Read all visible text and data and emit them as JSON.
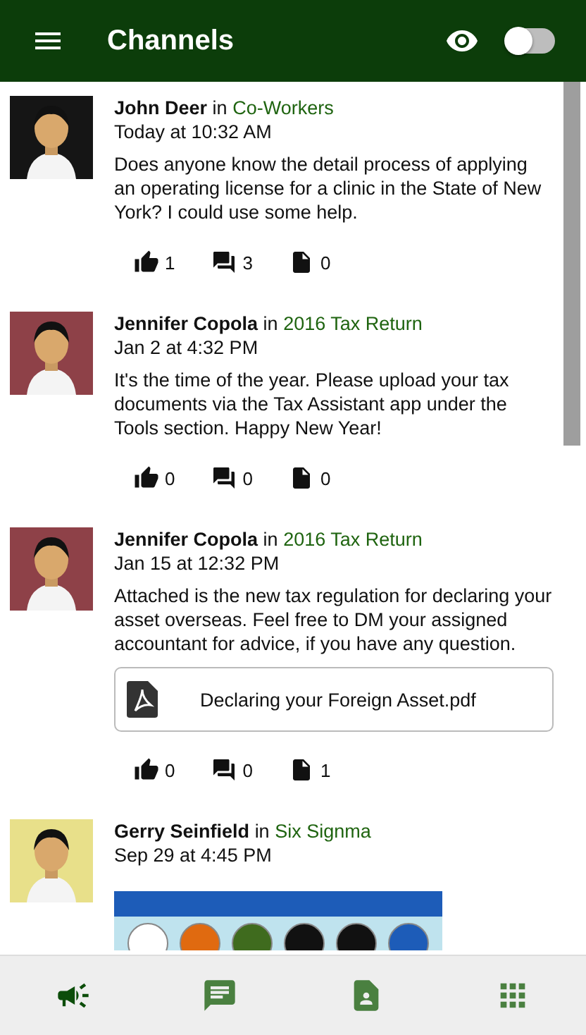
{
  "header": {
    "title": "Channels",
    "preview_toggle": {
      "on": false
    }
  },
  "posts": [
    {
      "author": "John Deer",
      "in": "in",
      "channel": "Co-Workers",
      "time": "Today at 10:32 AM",
      "color": "#151515",
      "body": "Does anyone know the detail process of applying an operating license for a clinic in the State of New York? I could use some help.",
      "likes": "1",
      "comments": "3",
      "files": "0"
    },
    {
      "author": "Jennifer Copola",
      "in": "in",
      "channel": "2016 Tax Return",
      "time": "Jan 2 at 4:32 PM",
      "color": "#8e4148",
      "body": "It's the time of the year. Please upload your tax documents via the Tax Assistant app under the Tools section. Happy New Year!",
      "likes": "0",
      "comments": "0",
      "files": "0"
    },
    {
      "author": "Jennifer Copola",
      "in": "in",
      "channel": "2016 Tax Return",
      "time": "Jan 15 at 12:32 PM",
      "color": "#8e4148",
      "body": "Attached is the new tax regulation for declaring your asset overseas. Feel free to DM your assigned accountant for advice, if you have any question.",
      "attachment": {
        "kind": "file",
        "name": "Declaring your Foreign Asset.pdf"
      },
      "likes": "0",
      "comments": "0",
      "files": "1"
    },
    {
      "author": "Gerry Seinfield",
      "in": "in",
      "channel": "Six Signma",
      "time": "Sep 29 at 4:45 PM",
      "color": "#e8e08a"
    }
  ],
  "nav": [
    {
      "kind": "megaphone",
      "selected": true
    },
    {
      "kind": "chat",
      "selected": false
    },
    {
      "kind": "contact",
      "selected": false
    },
    {
      "kind": "apps",
      "selected": false
    }
  ]
}
